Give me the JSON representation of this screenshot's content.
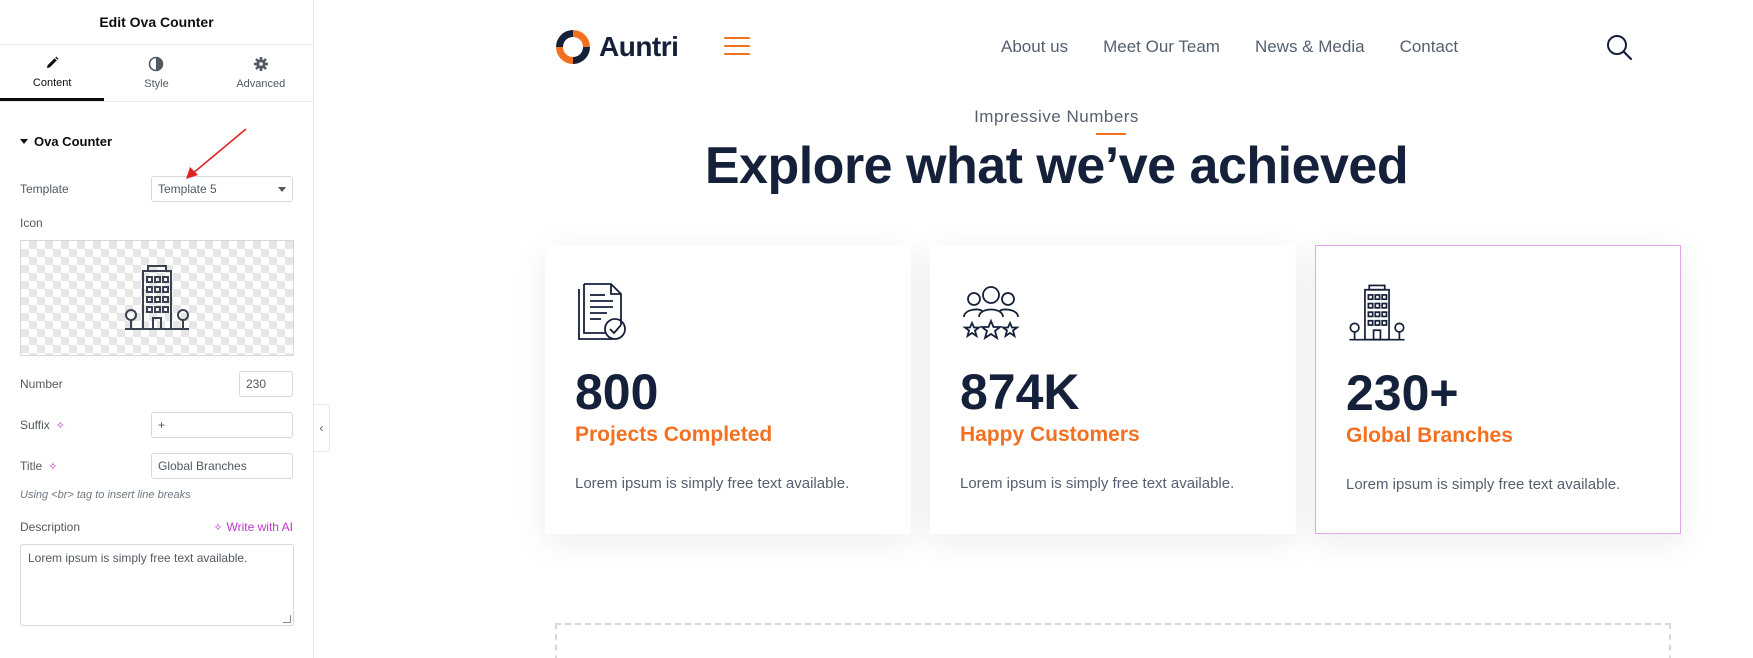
{
  "panel": {
    "title": "Edit Ova Counter",
    "tabs": [
      {
        "label": "Content",
        "icon": "pencil-icon",
        "active": true
      },
      {
        "label": "Style",
        "icon": "contrast-icon",
        "active": false
      },
      {
        "label": "Advanced",
        "icon": "gear-icon",
        "active": false
      }
    ],
    "section_title": "Ova Counter",
    "template_label": "Template",
    "template_value": "Template 5",
    "icon_label": "Icon",
    "number_label": "Number",
    "number_value": "230",
    "suffix_label": "Suffix",
    "suffix_value": "+",
    "title_label": "Title",
    "title_value": "Global Branches",
    "title_hint": "Using <br> tag to insert line breaks",
    "description_label": "Description",
    "write_ai_label": "Write with AI",
    "description_value": "Lorem ipsum is simply free text available."
  },
  "site": {
    "brand": "Auntri",
    "nav": [
      "About us",
      "Meet Our Team",
      "News & Media",
      "Contact"
    ],
    "eyebrow": "Impressive Numbers",
    "heading": "Explore what we’ve achieved",
    "cards": [
      {
        "number": "800",
        "title": "Projects Completed",
        "desc": "Lorem ipsum is simply free text available.",
        "icon": "document-check-icon"
      },
      {
        "number": "874K",
        "title": "Happy Customers",
        "desc": "Lorem ipsum is simply free text available.",
        "icon": "customers-stars-icon"
      },
      {
        "number": "230+",
        "title": "Global Branches",
        "desc": "Lorem ipsum is simply free text available.",
        "icon": "building-icon"
      }
    ]
  },
  "colors": {
    "accent": "#f37021",
    "navy": "#15213a",
    "ai": "#c036cc"
  }
}
